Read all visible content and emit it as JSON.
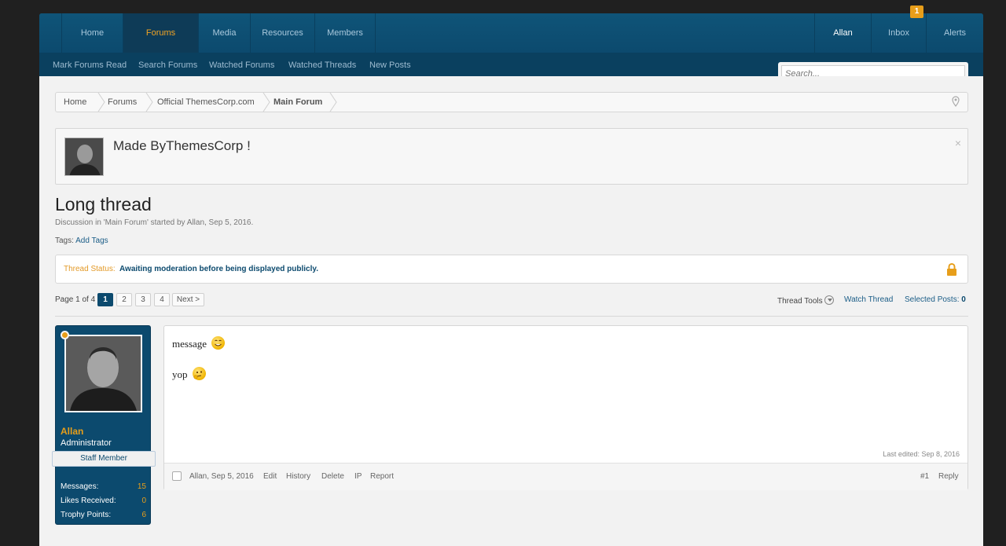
{
  "nav": {
    "tabs": [
      "Home",
      "Forums",
      "Media",
      "Resources",
      "Members"
    ],
    "active_tab": "Forums",
    "user": "Allan",
    "inbox": "Inbox",
    "alerts": "Alerts",
    "inbox_count": "1"
  },
  "subnav": [
    "Mark Forums Read",
    "Search Forums",
    "Watched Forums",
    "Watched Threads",
    "New Posts"
  ],
  "search": {
    "placeholder": "Search..."
  },
  "breadcrumb": [
    "Home",
    "Forums",
    "Official ThemesCorp.com",
    "Main Forum"
  ],
  "notice": {
    "text": "Made ByThemesCorp !",
    "close": "×"
  },
  "thread": {
    "title": "Long thread",
    "description": "Discussion in 'Main Forum' started by Allan, Sep 5, 2016.",
    "tags_label": "Tags:",
    "tags_add": "Add Tags",
    "status_label": "Thread Status:",
    "status_value": "Awaiting moderation before being displayed publicly."
  },
  "pager": {
    "label": "Page 1 of 4",
    "pages": [
      "1",
      "2",
      "3",
      "4"
    ],
    "current": "1",
    "next": "Next >"
  },
  "tools": {
    "thread_tools": "Thread Tools",
    "watch_thread": "Watch Thread",
    "selected_posts_label": "Selected Posts:",
    "selected_posts_count": "0"
  },
  "user_card": {
    "name": "Allan",
    "title": "Administrator",
    "badge": "Staff Member",
    "stats": [
      {
        "label": "Messages:",
        "value": "15"
      },
      {
        "label": "Likes Received:",
        "value": "0"
      },
      {
        "label": "Trophy Points:",
        "value": "6"
      }
    ]
  },
  "post": {
    "lines": [
      "message",
      "yop"
    ],
    "last_edited": "Last edited: Sep 8, 2016",
    "author_date": "Allan, Sep 5, 2016",
    "actions": [
      "Edit",
      "History",
      "Delete",
      "IP",
      "Report"
    ],
    "number": "#1",
    "reply": "Reply"
  },
  "colors": {
    "header": "#0c4a6e",
    "accent": "#e79e1a",
    "page_bg": "#f2f2f2"
  }
}
